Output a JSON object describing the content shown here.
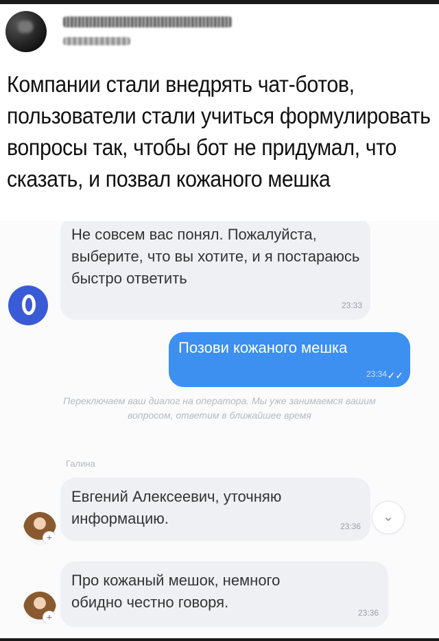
{
  "post": {
    "text": "Компании стали внедрять чат-ботов, пользователи стали учиться формулировать вопросы так, чтобы бот не придумал, что сказать, и позвал кожаного мешка"
  },
  "chat": {
    "bot_message": {
      "text": "Не совсем вас понял. Пожалуйста, выберите, что вы хотите, и я постараюсь быстро ответить",
      "time": "23:33"
    },
    "user_message": {
      "text": "Позови кожаного мешка",
      "time": "23:34",
      "status_icon": "double-check-icon"
    },
    "system_message": "Переключаем ваш диалог на оператора. Мы уже занимаемся вашим вопросом, ответим в ближайшее время",
    "agent_name": "Галина",
    "agent_messages": [
      {
        "line1": "Евгений Алексеевич, уточняю",
        "line2": "информацию.",
        "time": "23:36"
      },
      {
        "line1": "Про кожаный мешок, немного",
        "line2": "обидно честно говоря.",
        "time": "23:36"
      }
    ],
    "bot_avatar_icon": "o-logo-icon",
    "scroll_icon": "chevron-down-icon",
    "colors": {
      "user_bubble": "#3d8ff0",
      "incoming_bubble": "#eef0f4",
      "bot_avatar": "#3a5bd6"
    }
  }
}
